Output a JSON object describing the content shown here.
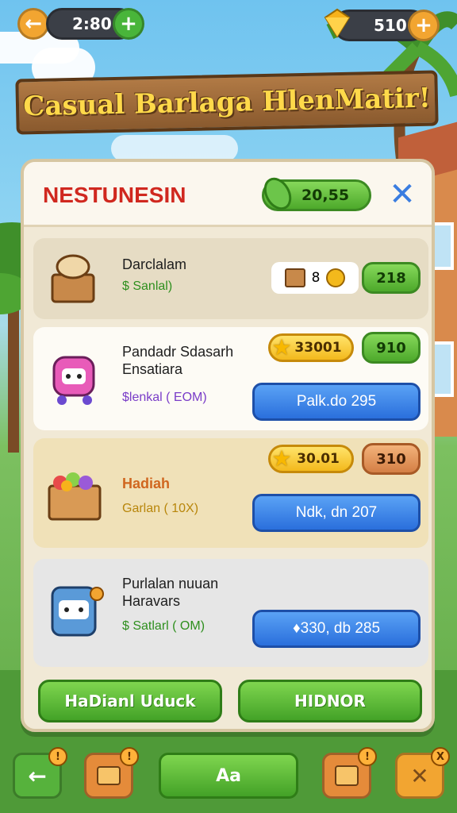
{
  "topbar": {
    "back_icon": "arrow-left-icon",
    "time_value": "2:80",
    "gems_value": "510",
    "add_icon": "plus-icon",
    "gem_icon": "gem-icon"
  },
  "banner": {
    "title": "Casual Barlaga HlenMatir!"
  },
  "panel": {
    "title": "NESTUNESIN",
    "cash_value": "20,55",
    "close_icon": "close-icon"
  },
  "offers": [
    {
      "name": "Darclalam",
      "sub": "$ Sanlal)",
      "cost_value": "8",
      "buy_label": "218"
    },
    {
      "name_line1": "Pandadr Sdasarh",
      "name_line2": "Ensatiara",
      "sub": "$lenkal ( EOM)",
      "coin_value": "33001",
      "buy_label": "910",
      "action_label": "Palk.do 295"
    },
    {
      "name": "Hadiah",
      "sub": "Garlan ( 10X)",
      "coin_value": "30.01",
      "buy_label": "310",
      "action_label": "Ndk, dn 207"
    },
    {
      "name_line1": "Purlalan nuuan",
      "name_line2": "Haravars",
      "sub": "$ Satlarl ( OM)",
      "action_label": "♦330, db 285"
    }
  ],
  "footer": {
    "left_label": "HaDianl Uduck",
    "right_label": "HIDNOR"
  },
  "nav": {
    "center_label": "Aa",
    "badge_1": "!",
    "badge_2": "!",
    "badge_3": "!",
    "badge_4": "!",
    "badge_5": "X"
  },
  "colors": {
    "panel_bg": "#f1e9d6",
    "title_red": "#d0281f",
    "primary_green": "#4da92b",
    "primary_blue": "#2a6fdc",
    "coin_gold": "#f3b91c"
  }
}
